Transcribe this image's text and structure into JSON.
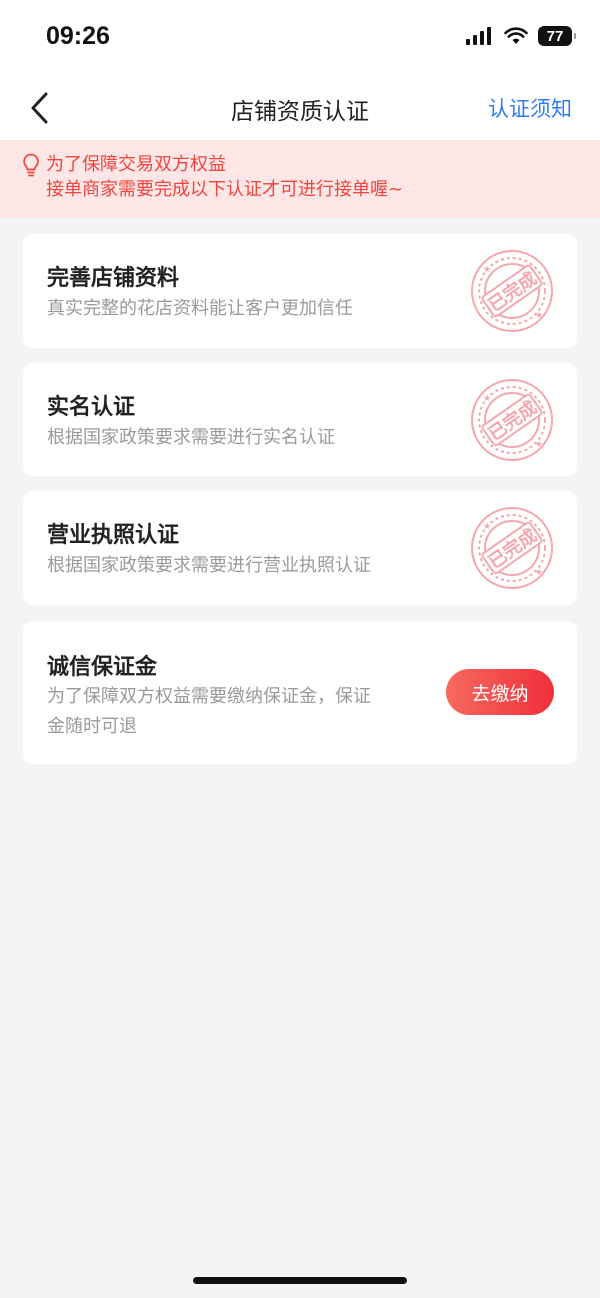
{
  "status_bar": {
    "time": "09:26",
    "battery": "77"
  },
  "nav": {
    "title": "店铺资质认证",
    "right_link": "认证须知"
  },
  "notice": {
    "line1": "为了保障交易双方权益",
    "line2": "接单商家需要完成以下认证才可进行接单喔~"
  },
  "cards": [
    {
      "title": "完善店铺资料",
      "desc": "真实完整的花店资料能让客户更加信任",
      "status": "已完成"
    },
    {
      "title": "实名认证",
      "desc": "根据国家政策要求需要进行实名认证",
      "status": "已完成"
    },
    {
      "title": "营业执照认证",
      "desc": "根据国家政策要求需要进行营业执照认证",
      "status": "已完成"
    },
    {
      "title": "诚信保证金",
      "desc_line1": "为了保障双方权益需要缴纳保证金，保证",
      "desc_line2": "金随时可退",
      "button": "去缴纳"
    }
  ],
  "colors": {
    "accent_red": "#ef2f3a",
    "link_blue": "#2e7df5",
    "notice_bg": "#fde7e6",
    "stamp": "#f4a8ad"
  }
}
